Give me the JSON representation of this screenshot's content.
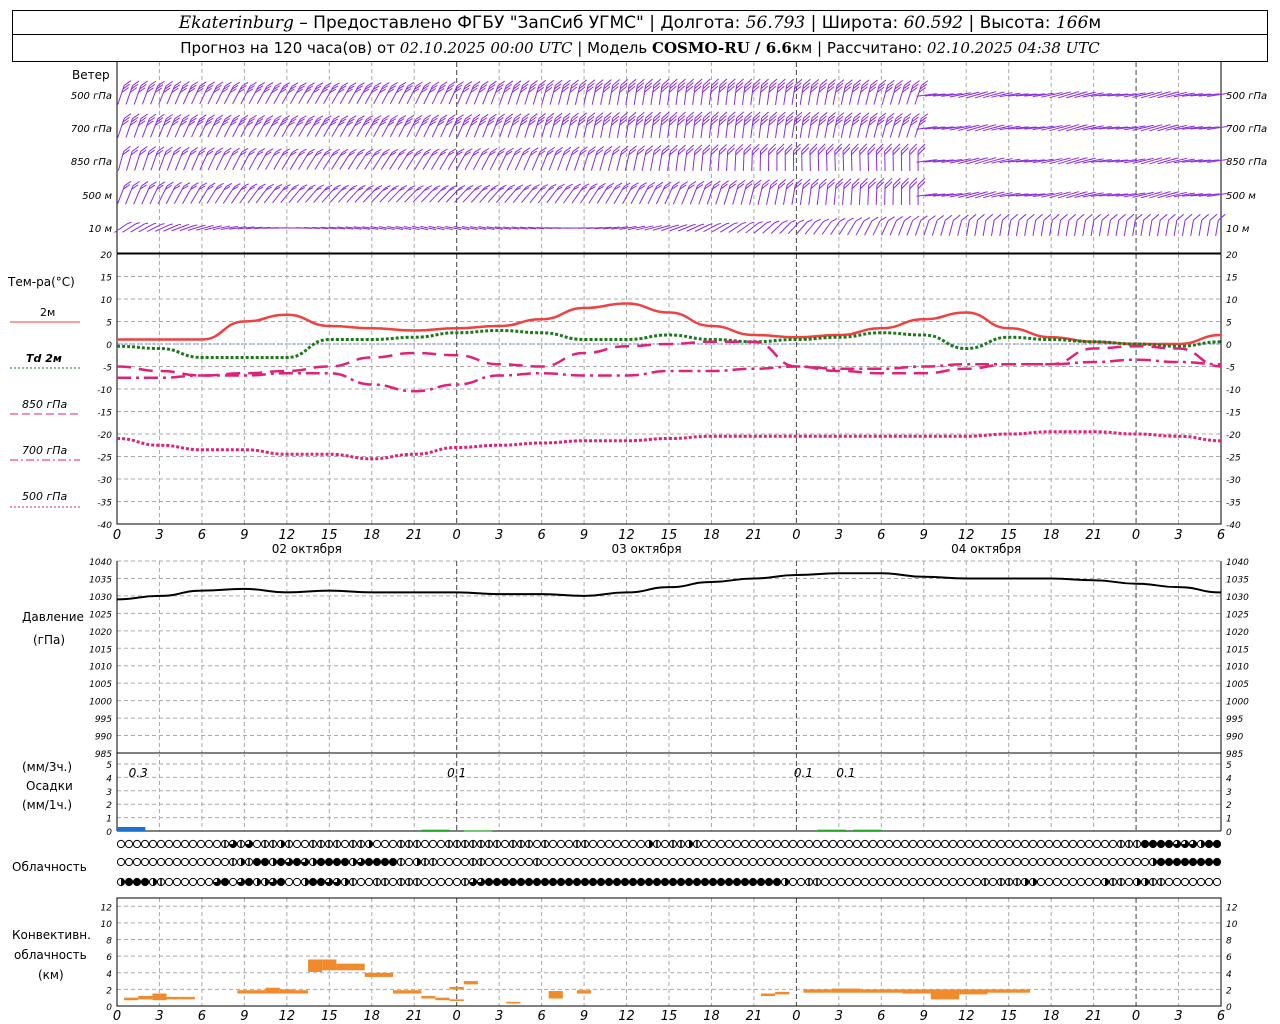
{
  "header": {
    "city": "Ekaterinburg",
    "provider": " – Предоставлено ФГБУ \"ЗапСиб УГМС\" | Долгота: ",
    "lon": "56.793",
    "lat_label": " | Широта: ",
    "lat": "60.592",
    "alt_label": " | Высота: ",
    "alt": "166",
    "alt_unit": "м",
    "forecast_prefix": "Прогноз на 120 часа(ов) от ",
    "forecast_time": "02.10.2025 00:00 UTC",
    "model_label": " | Модель ",
    "model": "COSMO-RU / 6.6",
    "model_unit": "км",
    "calc_label": " | Рассчитано: ",
    "calc_time": "02.10.2025 04:38 UTC"
  },
  "wind_panel": {
    "title": "Ветер",
    "levels": [
      "500 гПа",
      "700 гПа",
      "850 гПа",
      "500 м",
      "10  м"
    ],
    "color": "#8a2be2"
  },
  "temp_panel": {
    "title": "Тем-ра(°С)",
    "legend": [
      {
        "label": "2м",
        "color": "#f04040",
        "style": "solid"
      },
      {
        "label": "Td  2м",
        "color": "#1a7a1a",
        "style": "dotted"
      },
      {
        "label": "850 гПа",
        "color": "#e0207a",
        "style": "dash"
      },
      {
        "label": "700 гПа",
        "color": "#e0207a",
        "style": "dashdot"
      },
      {
        "label": "500 гПа",
        "color": "#e0207a",
        "style": "dotted"
      }
    ],
    "y_ticks": [
      "20",
      "15",
      "10",
      "5",
      "0",
      "-5",
      "-10",
      "-15",
      "-20",
      "-25",
      "-30",
      "-35",
      "-40"
    ],
    "x_ticks": [
      "0",
      "3",
      "6",
      "9",
      "12",
      "15",
      "18",
      "21",
      "0",
      "3",
      "6",
      "9",
      "12",
      "15",
      "18",
      "21",
      "0",
      "3",
      "6",
      "9",
      "12",
      "15",
      "18",
      "21",
      "0",
      "3",
      "6"
    ],
    "dates": [
      "02 октября",
      "03 октября",
      "04 октября"
    ]
  },
  "pressure_panel": {
    "title": "Давление",
    "unit": "(гПа)",
    "y_ticks": [
      "1040",
      "1035",
      "1030",
      "1025",
      "1020",
      "1015",
      "1010",
      "1005",
      "1000",
      "995",
      "990",
      "985"
    ]
  },
  "precip_panel": {
    "unit_top": "(мм/3ч.)",
    "title": "Осадки",
    "unit_bottom": "(мм/1ч.)",
    "y_ticks": [
      "5",
      "4",
      "3",
      "2",
      "1",
      "0"
    ],
    "annotations": [
      "0.3",
      "0.1",
      "0.1",
      "0.1"
    ]
  },
  "cloud_panel": {
    "title": "Облачность"
  },
  "conv_panel": {
    "title1": "Конвективн.",
    "title2": "облачность",
    "unit": "(км)",
    "y_ticks": [
      "12",
      "10",
      "8",
      "6",
      "4",
      "2",
      "0"
    ],
    "x_ticks": [
      "0",
      "3",
      "6",
      "9",
      "12",
      "15",
      "18",
      "21",
      "0",
      "3",
      "6",
      "9",
      "12",
      "15",
      "18",
      "21",
      "0",
      "3",
      "6",
      "9",
      "12",
      "15",
      "18",
      "21",
      "0",
      "3",
      "6"
    ]
  },
  "chart_data": [
    {
      "type": "line",
      "title": "Тем-ра(°С)",
      "x_hours": [
        0,
        3,
        6,
        9,
        12,
        15,
        18,
        21,
        24,
        27,
        30,
        33,
        36,
        39,
        42,
        45,
        48,
        51,
        54,
        57,
        60,
        63,
        66,
        69,
        72,
        75,
        78
      ],
      "ylim": [
        -40,
        20
      ],
      "series": [
        {
          "name": "2м",
          "values": [
            1,
            1,
            1,
            5,
            6.5,
            4,
            3.5,
            3,
            3.5,
            4,
            5.5,
            8,
            9,
            7,
            4,
            2,
            1.5,
            2,
            3.5,
            5.5,
            7,
            3.5,
            1.5,
            0.5,
            0,
            0,
            2
          ]
        },
        {
          "name": "Td  2м",
          "values": [
            -0.5,
            -1,
            -3,
            -3,
            -3,
            1,
            1,
            1.5,
            2.5,
            3,
            2.5,
            1,
            1,
            2,
            1,
            0.5,
            1,
            1.5,
            2.5,
            2,
            -1,
            1.5,
            1,
            0.5,
            0,
            -0.5,
            0.5
          ]
        },
        {
          "name": "850 гПа",
          "values": [
            -5,
            -6,
            -7,
            -6.5,
            -6,
            -5,
            -3,
            -2,
            -2.5,
            -4.5,
            -5,
            -2,
            -0.5,
            0,
            0.5,
            0.5,
            -5,
            -6,
            -6.5,
            -6.5,
            -5.5,
            -4.5,
            -4.5,
            -1,
            -0.5,
            -1,
            -5
          ]
        },
        {
          "name": "700 гПа",
          "values": [
            -7.5,
            -7.5,
            -7,
            -7,
            -6.5,
            -6.5,
            -9,
            -10.5,
            -9,
            -7,
            -6.5,
            -7,
            -7,
            -6,
            -6,
            -5.5,
            -5,
            -5.5,
            -5.5,
            -5,
            -4.5,
            -4.5,
            -4.5,
            -4,
            -3.5,
            -4,
            -4.5
          ]
        },
        {
          "name": "500 гПа",
          "values": [
            -21,
            -22.5,
            -23.5,
            -23.5,
            -24.5,
            -24.5,
            -25.5,
            -24.5,
            -23,
            -22.5,
            -22,
            -21.5,
            -21.5,
            -21,
            -20.5,
            -20.5,
            -20.5,
            -20.5,
            -20.5,
            -20.5,
            -20.5,
            -20,
            -19.5,
            -19.5,
            -20,
            -20.5,
            -21.5
          ]
        }
      ]
    },
    {
      "type": "line",
      "title": "Давление",
      "x_hours": [
        0,
        3,
        6,
        9,
        12,
        15,
        18,
        21,
        24,
        27,
        30,
        33,
        36,
        39,
        42,
        45,
        48,
        51,
        54,
        57,
        60,
        63,
        66,
        69,
        72,
        75,
        78
      ],
      "ylim": [
        985,
        1040
      ],
      "series": [
        {
          "name": "",
          "values": [
            1029,
            1030,
            1031.5,
            1032,
            1031,
            1031.5,
            1031,
            1031,
            1031,
            1030.5,
            1030.5,
            1030,
            1031,
            1032.5,
            1034,
            1035,
            1036,
            1036.5,
            1036.5,
            1035.5,
            1035,
            1035,
            1035,
            1034.5,
            1033.5,
            1032.5,
            1031
          ]
        }
      ]
    },
    {
      "type": "bar",
      "title": "Осадки",
      "ylim": [
        0,
        5
      ],
      "bars": [
        {
          "x_hours": 1,
          "value": 0.3,
          "color": "#1f6fd0"
        },
        {
          "x_hours": 22.5,
          "value": 0.1,
          "color": "#22aa22"
        },
        {
          "x_hours": 25.5,
          "value": 0.05,
          "color": "#22aa22"
        },
        {
          "x_hours": 50.5,
          "value": 0.1,
          "color": "#22aa22"
        },
        {
          "x_hours": 53,
          "value": 0.1,
          "color": "#22aa22"
        }
      ]
    },
    {
      "type": "bar",
      "title": "Конвективн. облачность",
      "ylim": [
        0,
        13
      ],
      "bars": [
        {
          "x0": 0.5,
          "x1": 1.5,
          "base": 0.7,
          "top": 1.0
        },
        {
          "x0": 1.5,
          "x1": 2.5,
          "base": 0.8,
          "top": 1.2
        },
        {
          "x0": 2.5,
          "x1": 3.5,
          "base": 0.7,
          "top": 1.5
        },
        {
          "x0": 3.5,
          "x1": 4.5,
          "base": 0.8,
          "top": 1.1
        },
        {
          "x0": 4.5,
          "x1": 5.5,
          "base": 0.8,
          "top": 1.1
        },
        {
          "x0": 8.5,
          "x1": 10.5,
          "base": 1.5,
          "top": 1.9
        },
        {
          "x0": 10.5,
          "x1": 11.5,
          "base": 1.5,
          "top": 2.2
        },
        {
          "x0": 11.5,
          "x1": 12.5,
          "base": 1.5,
          "top": 2.0
        },
        {
          "x0": 12.5,
          "x1": 13.5,
          "base": 1.5,
          "top": 1.9
        },
        {
          "x0": 13.5,
          "x1": 14.5,
          "base": 4.1,
          "top": 5.6
        },
        {
          "x0": 14.5,
          "x1": 15.5,
          "base": 4.3,
          "top": 5.6
        },
        {
          "x0": 15.5,
          "x1": 17.5,
          "base": 4.3,
          "top": 5.1
        },
        {
          "x0": 17.5,
          "x1": 19.5,
          "base": 3.5,
          "top": 4.0
        },
        {
          "x0": 19.5,
          "x1": 21.5,
          "base": 1.5,
          "top": 1.9
        },
        {
          "x0": 21.5,
          "x1": 22.5,
          "base": 0.9,
          "top": 1.2
        },
        {
          "x0": 22.5,
          "x1": 23.5,
          "base": 0.7,
          "top": 1.0
        },
        {
          "x0": 23.5,
          "x1": 24.5,
          "base": 2.0,
          "top": 2.3
        },
        {
          "x0": 23.5,
          "x1": 24.5,
          "base": 0.6,
          "top": 0.8
        },
        {
          "x0": 24.5,
          "x1": 25.5,
          "base": 2.6,
          "top": 3.0
        },
        {
          "x0": 27.5,
          "x1": 28.5,
          "base": 0.3,
          "top": 0.5
        },
        {
          "x0": 30.5,
          "x1": 31.5,
          "base": 0.9,
          "top": 1.8
        },
        {
          "x0": 32.5,
          "x1": 33.5,
          "base": 1.5,
          "top": 1.9
        },
        {
          "x0": 45.5,
          "x1": 46.5,
          "base": 1.2,
          "top": 1.5
        },
        {
          "x0": 46.5,
          "x1": 47.5,
          "base": 1.4,
          "top": 1.7
        },
        {
          "x0": 48.5,
          "x1": 50.5,
          "base": 1.6,
          "top": 2.0
        },
        {
          "x0": 50.5,
          "x1": 52.5,
          "base": 1.6,
          "top": 2.1
        },
        {
          "x0": 52.5,
          "x1": 55.5,
          "base": 1.6,
          "top": 2.0
        },
        {
          "x0": 55.5,
          "x1": 57.5,
          "base": 1.5,
          "top": 2.0
        },
        {
          "x0": 57.5,
          "x1": 59.5,
          "base": 0.8,
          "top": 2.0
        },
        {
          "x0": 59.5,
          "x1": 61.5,
          "base": 1.4,
          "top": 2.0
        },
        {
          "x0": 61.5,
          "x1": 63.5,
          "base": 1.6,
          "top": 2.0
        },
        {
          "x0": 63.5,
          "x1": 64.5,
          "base": 1.6,
          "top": 2.0
        }
      ]
    }
  ],
  "cloud_rows": {
    "upper": "000000000000013130112100111101120001110001111111011101000110000000210112100000000000000000000000000000000000000000000000000001114444333244",
    "middle": "000000000000001214424343244442344441021100001100000010000000000000000000000000000000000000000000000000000000000000000000000000000244444444",
    "lower": "244421000000340342234002443321001101110000013344444444444444444444444444444444444442001100000000000000000000101112200000000211022110000000"
  },
  "wind_codes": {
    "L500": "ABBBBBBBBBBBBBBBBBBBBBBBBBBBBBBBBBBBBBBBBBBBBBBBBBBBBBBBBBBBBBBBBBBBBBBBBBBBBBBBBBBBBBBBBBBBBBBBBBBBBBBBBBBBBBBBBBBBBBBBBBBBBBBBBBBBBBBBBBBBBB",
    "L700": "ABBBBBBBBBBBBBBBBBBBBBBBBBBBBBBBBBBBBBBBBBBBBBBBBBBBBBBBBBBBBBBBBBBBBBBBBBBBBBBBBBBBBBBBBBBBBBBBBBBBBBBBBBBBBBBBBBBBBBBBBBBBBBBBBBBBBBBBBBBBBB",
    "L850": "BBBBBBBBBBBBBBBBBBBBBBBBBBBBBBBBBBBBBBBBBBBBBBBBBBBBBBBBBBBBBBBBBBBBBBBBBBBBBBBBBBBBBBBBBBBBBBBBBBBBBBBBBBBBBBBBBBBBBBBBBBBBBBBBBBBBBBBBBBBB",
    "L500m": "BBBBBBBBBBBBBBBBBBBBBBBBBBBBBBBBBBBBBBBBBBBBBBBBBBBBBBBBBBBBBBBBBBBBBBBBBBBBBBBBBBBBBBBBBBBBBBBBBBBBBBBBBBBBBBBBBBBBBBBBBBBBBBBBBBBBBBBBBBBB",
    "L10m": "CCCCCCCCCCCCCCCCCCCCCCCCCCCCCCCCCCCCCCCCCCCCCCCCCCCCCCCCCCCCCCCCCCCCCCCCCCCCCCCCCCCCCCCCCCCCCCCCCCCCCCCCCCCCCCCCCCCCCCCCCCCCCCCCCCCCCCCCCCCCC"
  }
}
